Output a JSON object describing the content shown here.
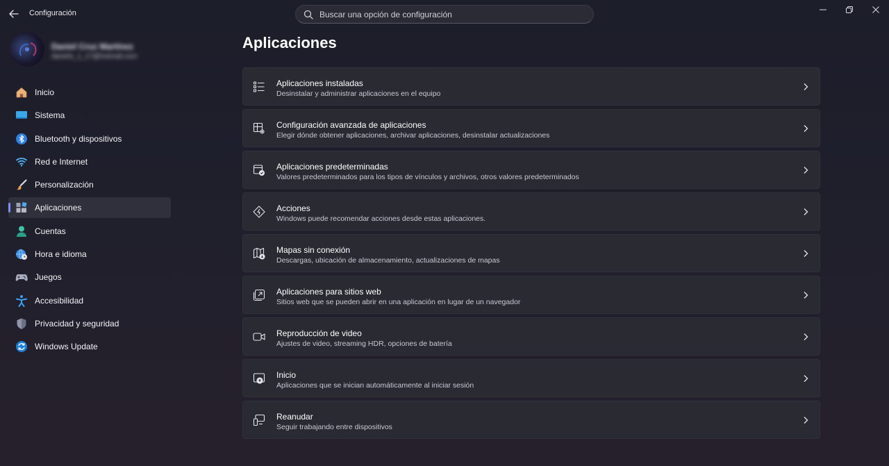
{
  "window": {
    "title": "Configuración",
    "search_placeholder": "Buscar una opción de configuración"
  },
  "profile": {
    "name": "Daniel Cruz Martínez",
    "email": "daniels_1_17@hotmail.com"
  },
  "sidebar": {
    "items": [
      {
        "label": "Inicio",
        "icon": "home-icon",
        "selected": false
      },
      {
        "label": "Sistema",
        "icon": "system-icon",
        "selected": false
      },
      {
        "label": "Bluetooth y dispositivos",
        "icon": "bluetooth-icon",
        "selected": false
      },
      {
        "label": "Red e Internet",
        "icon": "wifi-icon",
        "selected": false
      },
      {
        "label": "Personalización",
        "icon": "brush-icon",
        "selected": false
      },
      {
        "label": "Aplicaciones",
        "icon": "apps-icon",
        "selected": true
      },
      {
        "label": "Cuentas",
        "icon": "account-icon",
        "selected": false
      },
      {
        "label": "Hora e idioma",
        "icon": "globe-clock-icon",
        "selected": false
      },
      {
        "label": "Juegos",
        "icon": "gamepad-icon",
        "selected": false
      },
      {
        "label": "Accesibilidad",
        "icon": "accessibility-icon",
        "selected": false
      },
      {
        "label": "Privacidad y seguridad",
        "icon": "shield-icon",
        "selected": false
      },
      {
        "label": "Windows Update",
        "icon": "update-icon",
        "selected": false
      }
    ]
  },
  "main": {
    "title": "Aplicaciones",
    "cards": [
      {
        "title": "Aplicaciones instaladas",
        "description": "Desinstalar y administrar aplicaciones en el equipo",
        "icon": "list-icon"
      },
      {
        "title": "Configuración avanzada de aplicaciones",
        "description": "Elegir dónde obtener aplicaciones, archivar aplicaciones, desinstalar actualizaciones",
        "icon": "app-settings-icon"
      },
      {
        "title": "Aplicaciones predeterminadas",
        "description": "Valores predeterminados para los tipos de vínculos y archivos, otros valores predeterminados",
        "icon": "default-apps-icon"
      },
      {
        "title": "Acciones",
        "description": "Windows puede recomendar acciones desde estas aplicaciones.",
        "icon": "actions-icon"
      },
      {
        "title": "Mapas sin conexión",
        "description": "Descargas, ubicación de almacenamiento, actualizaciones de mapas",
        "icon": "map-icon"
      },
      {
        "title": "Aplicaciones para sitios web",
        "description": "Sitios web que se pueden abrir en una aplicación en lugar de un navegador",
        "icon": "open-external-icon"
      },
      {
        "title": "Reproducción de video",
        "description": "Ajustes de video, streaming HDR, opciones de batería",
        "icon": "video-icon"
      },
      {
        "title": "Inicio",
        "description": "Aplicaciones que se inician automáticamente al iniciar sesión",
        "icon": "startup-icon"
      },
      {
        "title": "Reanudar",
        "description": "Seguir trabajando entre dispositivos",
        "icon": "devices-icon"
      }
    ]
  },
  "colors": {
    "accent": "#7c8ff0",
    "card_bg": "#2a2a33",
    "background": "#1f1f2c"
  }
}
